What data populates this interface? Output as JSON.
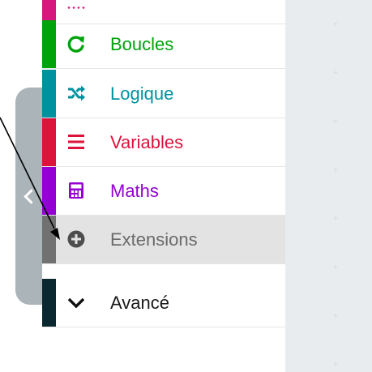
{
  "toolbox": {
    "categories": [
      {
        "label": "Boucles",
        "color": "#00a30a",
        "icon": "refresh-loop-icon"
      },
      {
        "label": "Logique",
        "color": "#00929f",
        "icon": "shuffle-icon"
      },
      {
        "label": "Variables",
        "color": "#dc143c",
        "icon": "list-lines-icon"
      },
      {
        "label": "Maths",
        "color": "#9400d3",
        "icon": "calculator-icon"
      },
      {
        "label": "Extensions",
        "color": "#717171",
        "icon": "plus-circle-icon",
        "selected": true
      },
      {
        "label": "Avancé",
        "color": "#0b2830",
        "icon": "chevron-down-icon"
      }
    ],
    "top_partial_color": "#d6177d"
  },
  "collapse_tab": {
    "icon": "chevron-left-icon",
    "color": "#aab4b9"
  },
  "workspace": {
    "background": "#e9ecef"
  },
  "annotation": {
    "icon": "arrow-pointer-icon",
    "target": "Extensions"
  }
}
